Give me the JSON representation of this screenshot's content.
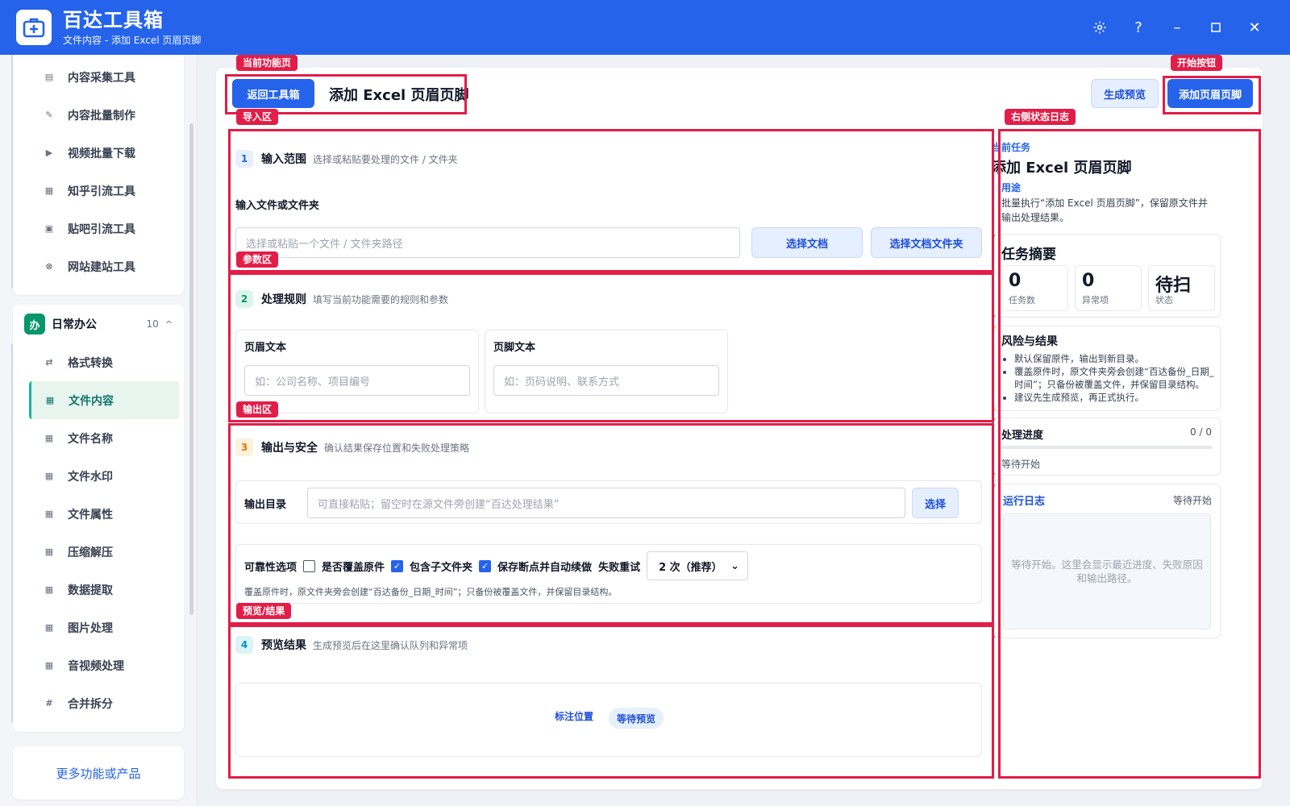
{
  "app": {
    "title": "百达工具箱",
    "subtitle": "文件内容 - 添加 Excel 页眉页脚",
    "controls": [
      "⚙",
      "?",
      "–",
      "☐",
      "✕"
    ]
  },
  "sidebar": {
    "top_items": [
      {
        "label": "内容采集工具",
        "icon": "document-icon"
      },
      {
        "label": "内容批量制作",
        "icon": "pen-icon"
      },
      {
        "label": "视频批量下载",
        "icon": "video-icon"
      },
      {
        "label": "知乎引流工具",
        "icon": "zhihu-icon"
      },
      {
        "label": "贴吧引流工具",
        "icon": "tieba-icon"
      },
      {
        "label": "网站建站工具",
        "icon": "website-icon"
      }
    ],
    "group": {
      "badge": "办",
      "title": "日常办公",
      "count": "10",
      "caret": "^"
    },
    "group_items": [
      {
        "label": "格式转换",
        "icon": "swap-icon",
        "active": false
      },
      {
        "label": "文件内容",
        "icon": "grid-icon",
        "active": true
      },
      {
        "label": "文件名称",
        "icon": "grid-icon",
        "active": false
      },
      {
        "label": "文件水印",
        "icon": "grid-icon",
        "active": false
      },
      {
        "label": "文件属性",
        "icon": "grid-icon",
        "active": false
      },
      {
        "label": "压缩解压",
        "icon": "grid-icon",
        "active": false
      },
      {
        "label": "数据提取",
        "icon": "grid-icon",
        "active": false
      },
      {
        "label": "图片处理",
        "icon": "grid-icon",
        "active": false
      },
      {
        "label": "音视频处理",
        "icon": "grid-icon",
        "active": false
      },
      {
        "label": "合并拆分",
        "icon": "hash-icon",
        "active": false
      }
    ],
    "more_label": "更多功能或产品"
  },
  "header": {
    "back_label": "返回工具箱",
    "title": "添加 Excel 页眉页脚",
    "preview_label": "生成预览",
    "start_label": "添加页眉页脚"
  },
  "annotations": {
    "current_page": "当前功能页",
    "start_button": "开始按钮",
    "import_area": "导入区",
    "right_log": "右侧状态日志",
    "param_area": "参数区",
    "output_area": "输出区",
    "preview_result": "预览/结果"
  },
  "section1": {
    "num": "1",
    "name": "输入范围",
    "desc": "选择或粘贴要处理的文件 / 文件夹",
    "field_label": "输入文件或文件夹",
    "input_placeholder": "选择或粘贴一个文件 / 文件夹路径",
    "btn_doc": "选择文档",
    "btn_folder": "选择文档文件夹"
  },
  "section2": {
    "num": "2",
    "name": "处理规则",
    "desc": "填写当前功能需要的规则和参数",
    "header_label": "页眉文本",
    "header_placeholder": "如：公司名称、项目编号",
    "footer_label": "页脚文本",
    "footer_placeholder": "如：页码说明、联系方式"
  },
  "section3": {
    "num": "3",
    "name": "输出与安全",
    "desc": "确认结果保存位置和失败处理策略",
    "outdir_label": "输出目录",
    "outdir_placeholder": "可直接粘贴；留空时在源文件旁创建“百达处理结果”",
    "outdir_btn": "选择",
    "reliability_label": "可靠性选项",
    "opt_overwrite": "是否覆盖原件",
    "opt_subfolder": "包含子文件夹",
    "opt_resume": "保存断点并自动续做",
    "retry_label": "失败重试",
    "retry_value": "2 次（推荐）",
    "note": "覆盖原件时，原文件夹旁会创建“百达备份_日期_时间”；只备份被覆盖文件，并保留目录结构。"
  },
  "section4": {
    "num": "4",
    "name": "预览结果",
    "desc": "生成预览后在这里确认队列和异常项",
    "mark_label": "标注位置",
    "pill": "等待预览"
  },
  "right": {
    "current_task_label": "当前任务",
    "current_task": "添加 Excel 页眉页脚",
    "purpose_label": "用途",
    "purpose_text": "批量执行“添加 Excel 页眉页脚”，保留原文件并输出处理结果。",
    "summary_title": "任务摘要",
    "stats": [
      {
        "value": "0",
        "label": "任务数"
      },
      {
        "value": "0",
        "label": "异常项"
      },
      {
        "value": "待扫",
        "label": "状态"
      }
    ],
    "risk_title": "风险与结果",
    "risks": [
      "默认保留原件，输出到新目录。",
      "覆盖原件时，原文件夹旁会创建“百达备份_日期_时间”；只备份被覆盖文件，并保留目录结构。",
      "建议先生成预览，再正式执行。"
    ],
    "progress_title": "处理进度",
    "progress_count": "0 / 0",
    "progress_fraction": 0,
    "progress_status": "等待开始",
    "log_title": "运行日志",
    "log_status": "等待开始",
    "log_placeholder": "等待开始。这里会显示最近进度、失败原因和输出路径。"
  },
  "colors": {
    "primary": "#2563eb",
    "annotation": "#e11d48",
    "active_green": "#0f766e"
  }
}
